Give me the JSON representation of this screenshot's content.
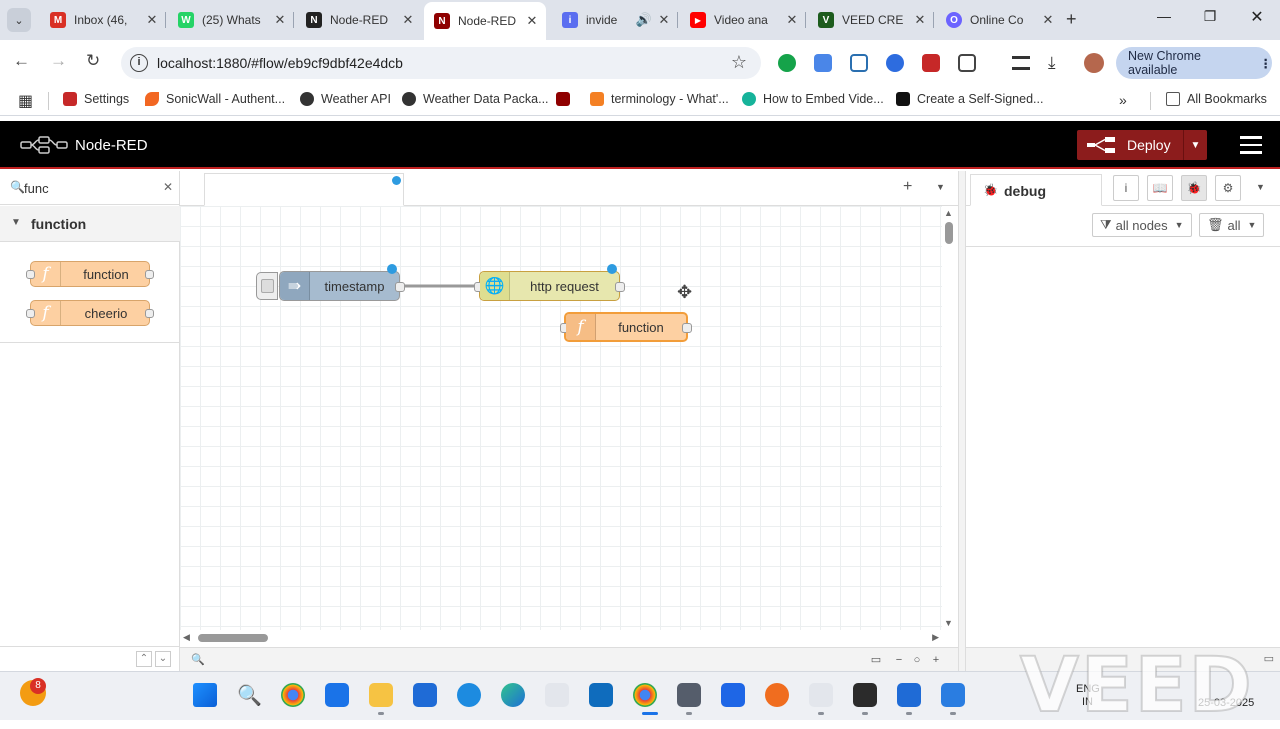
{
  "browser": {
    "tabs": [
      {
        "title": "Inbox (46,",
        "color": "#d93025",
        "glyph": "M",
        "active": false
      },
      {
        "title": "(25) Whats",
        "color": "#25d366",
        "glyph": "W",
        "active": false
      },
      {
        "title": "Node-RED",
        "color": "#222222",
        "glyph": "N",
        "active": false
      },
      {
        "title": "Node-RED",
        "color": "#8f0000",
        "glyph": "N",
        "active": true
      },
      {
        "title": "invide",
        "color": "#5b6ef0",
        "glyph": "i",
        "active": false
      },
      {
        "title": "Video ana",
        "color": "#ff0000",
        "glyph": "▶",
        "active": false
      },
      {
        "title": "VEED CRE",
        "color": "#1d5c1d",
        "glyph": "V",
        "active": false
      },
      {
        "title": "Online Co",
        "color": "#6c63ff",
        "glyph": "O",
        "active": false
      }
    ],
    "url": "localhost:1880/#flow/eb9cf9dbf42e4dcb",
    "new_chrome": "New Chrome available",
    "bookmarks": [
      {
        "label": "Settings",
        "color": "#c62828"
      },
      {
        "label": "SonicWall - Authent...",
        "color": "#f26722"
      },
      {
        "label": "Weather API",
        "color": "#333333"
      },
      {
        "label": "Weather Data Packa...",
        "color": "#333333"
      },
      {
        "label": "",
        "color": "#8f0000"
      },
      {
        "label": "terminology - What'...",
        "color": "#f48024"
      },
      {
        "label": "How to Embed Vide...",
        "color": "#16b39a"
      },
      {
        "label": "Create a Self-Signed...",
        "color": "#111111"
      }
    ],
    "all_bookmarks": "All Bookmarks"
  },
  "nodered": {
    "title": "Node-RED",
    "deploy": "Deploy",
    "palette": {
      "search_value": "func",
      "category": "function",
      "nodes": [
        "function",
        "cheerio"
      ]
    },
    "flow_nodes": {
      "timestamp": "timestamp",
      "http_request": "http request",
      "function": "function"
    },
    "sidebar": {
      "tab": "debug",
      "filter": "all nodes",
      "clear": "all"
    }
  },
  "taskbar": {
    "weather_badge": "8",
    "lang_line1": "ENG",
    "lang_line2": "IN",
    "date": "25-03-2025"
  },
  "watermark": "VEED"
}
